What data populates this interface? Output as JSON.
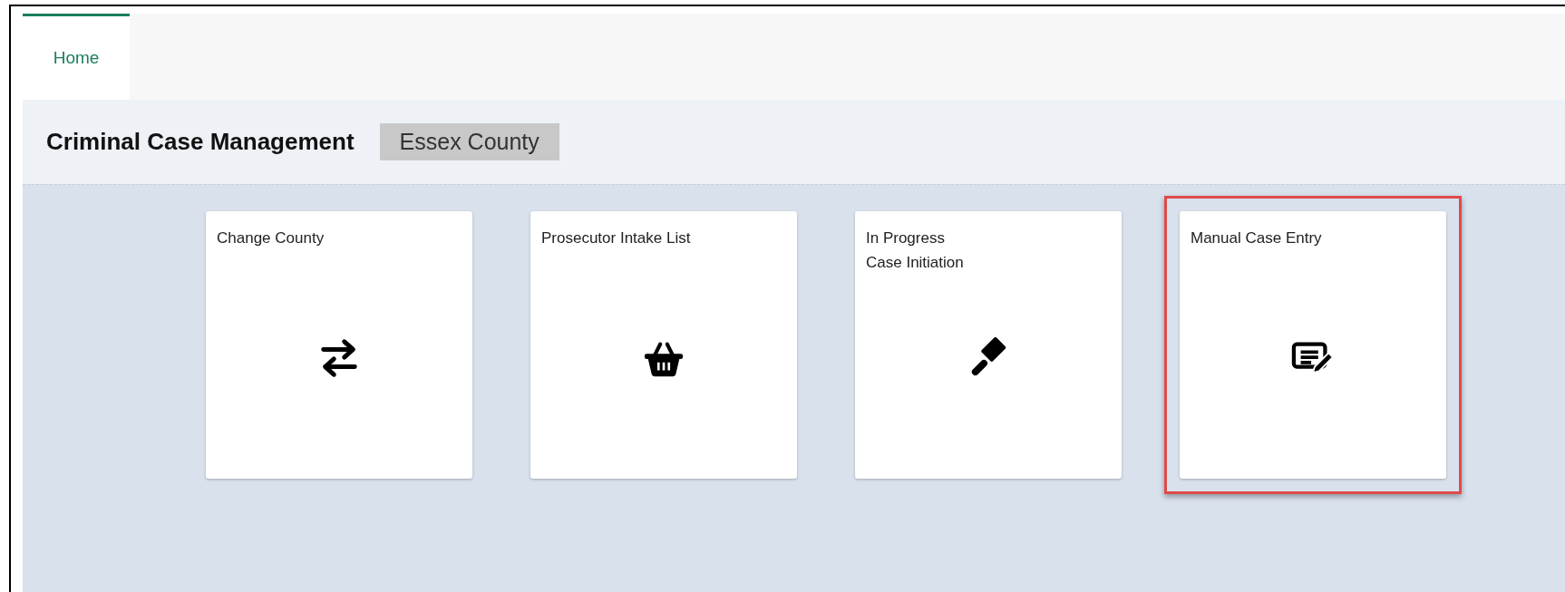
{
  "tabs": [
    {
      "label": "Home",
      "selected": true
    }
  ],
  "header": {
    "title": "Criminal Case Management",
    "county": "Essex County"
  },
  "tiles": [
    {
      "title": "Change County",
      "highlighted": false
    },
    {
      "title": "Prosecutor Intake List",
      "highlighted": false
    },
    {
      "title": "In Progress\nCase Initiation",
      "highlighted": false
    },
    {
      "title": "Manual Case Entry",
      "highlighted": true
    }
  ]
}
